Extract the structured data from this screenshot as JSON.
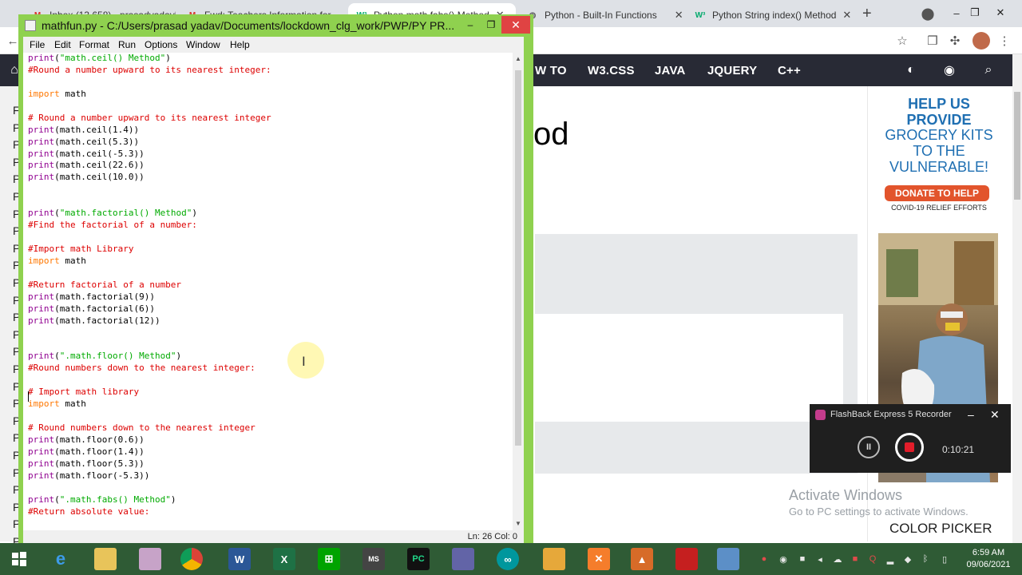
{
  "browser": {
    "tabs": [
      {
        "label": "Inbox (13,658) - prasadyadav5",
        "icon": "gmail-icon",
        "active": false
      },
      {
        "label": "Fwd: Teachers Information for",
        "icon": "gmail-icon",
        "active": false
      },
      {
        "label": "Python math.fabs() Method",
        "icon": "w3schools-icon",
        "active": true
      },
      {
        "label": "Python - Built-In Functions",
        "icon": "globe-icon",
        "active": false
      },
      {
        "label": "Python String index() Method",
        "icon": "w3schools-icon",
        "active": false
      }
    ],
    "new_tab": "+",
    "window_controls": [
      "–",
      "❐",
      "✕"
    ]
  },
  "w3": {
    "nav": [
      "W TO",
      "W3.CSS",
      "JAVA",
      "JQUERY",
      "C++"
    ],
    "heading_fragment": "od",
    "left_letters": [
      "F",
      "P",
      "P",
      "P",
      "P",
      "P",
      "P",
      "P",
      "P",
      "P",
      "P",
      "P",
      "P",
      "P",
      "P",
      "P",
      "P",
      "P",
      "P",
      "P",
      "P",
      "P",
      "P",
      "P",
      "P",
      "P"
    ],
    "ad": {
      "line1": "HELP US PROVIDE",
      "line2": "GROCERY KITS TO THE VULNERABLE!",
      "button": "DONATE TO HELP",
      "sub": "COVID-19 RELIEF EFFORTS"
    },
    "activate_title": "Activate Windows",
    "activate_sub": "Go to PC settings to activate Windows.",
    "color_picker": "COLOR PICKER"
  },
  "idle": {
    "title": "mathfun.py - C:/Users/prasad yadav/Documents/lockdown_clg_work/PWP/PY PR...",
    "menu": [
      "File",
      "Edit",
      "Format",
      "Run",
      "Options",
      "Window",
      "Help"
    ],
    "status": "Ln: 26    Col: 0",
    "code": [
      "print(\"math.ceil() Method\")",
      "#Round a number upward to its nearest integer:",
      "",
      "import math",
      "",
      "# Round a number upward to its nearest integer",
      "print(math.ceil(1.4))",
      "print(math.ceil(5.3))",
      "print(math.ceil(-5.3))",
      "print(math.ceil(22.6))",
      "print(math.ceil(10.0))",
      "",
      "",
      "print(\"math.factorial() Method\")",
      "#Find the factorial of a number:",
      "",
      "#Import math Library",
      "import math",
      "",
      "#Return factorial of a number",
      "print(math.factorial(9))",
      "print(math.factorial(6))",
      "print(math.factorial(12))",
      "",
      "",
      "print(\".math.floor() Method\")",
      "#Round numbers down to the nearest integer:",
      "",
      "# Import math library",
      "import math",
      "",
      "# Round numbers down to the nearest integer",
      "print(math.floor(0.6))",
      "print(math.floor(1.4))",
      "print(math.floor(5.3))",
      "print(math.floor(-5.3))",
      "",
      "print(\".math.fabs() Method\")",
      "#Return absolute value:"
    ]
  },
  "recorder": {
    "title": "FlashBack Express 5 Recorder",
    "time": "0:10:21",
    "minimize": "–",
    "close": "✕"
  },
  "taskbar": {
    "clock_time": "6:59 AM",
    "clock_date": "09/06/2021"
  }
}
